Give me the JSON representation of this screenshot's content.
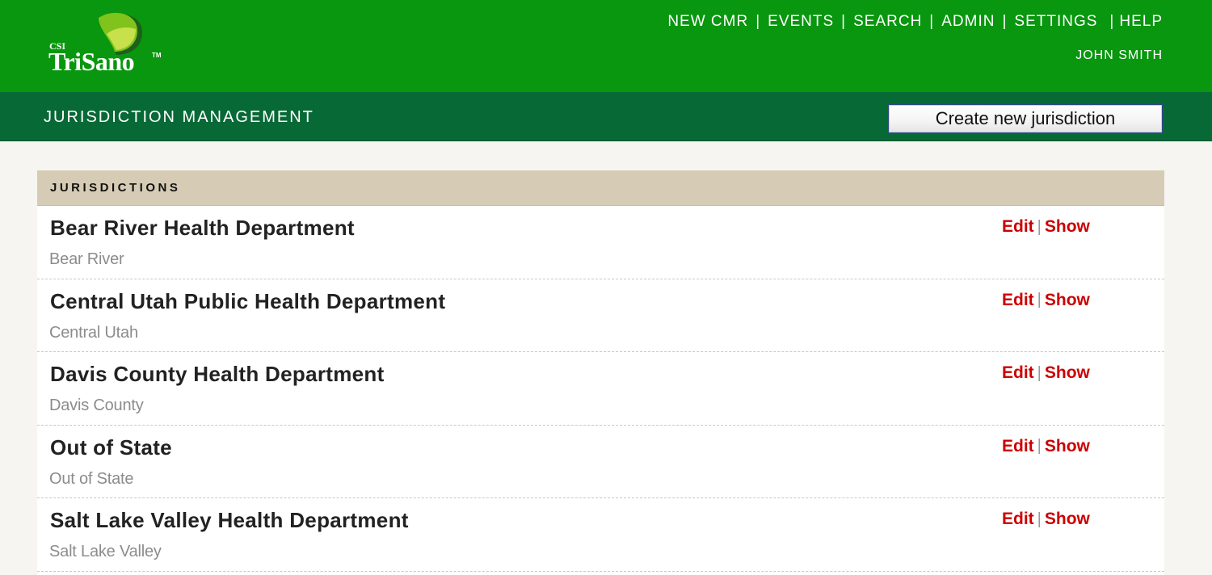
{
  "logo": {
    "small": "CSI",
    "brand": "TriSano",
    "tm": "TM"
  },
  "nav": {
    "items": [
      "NEW CMR",
      "EVENTS",
      "SEARCH",
      "ADMIN",
      "SETTINGS",
      "HELP"
    ],
    "separator": "|",
    "user": "JOHN SMITH"
  },
  "page": {
    "title": "JURISDICTION MANAGEMENT",
    "create_button": "Create new jurisdiction"
  },
  "panel": {
    "header": "JURISDICTIONS",
    "rows": [
      {
        "name": "Bear River Health Department",
        "short": "Bear River",
        "edit": "Edit",
        "sep": "|",
        "show": "Show"
      },
      {
        "name": "Central Utah Public Health Department",
        "short": "Central Utah",
        "edit": "Edit",
        "sep": "|",
        "show": "Show"
      },
      {
        "name": "Davis County Health Department",
        "short": "Davis County",
        "edit": "Edit",
        "sep": "|",
        "show": "Show"
      },
      {
        "name": "Out of State",
        "short": "Out of State",
        "edit": "Edit",
        "sep": "|",
        "show": "Show"
      },
      {
        "name": "Salt Lake Valley Health Department",
        "short": "Salt Lake Valley",
        "edit": "Edit",
        "sep": "|",
        "show": "Show"
      }
    ]
  },
  "colors": {
    "topbar": "#08970e",
    "subbar": "#076936",
    "panel_header": "#d6cbb4",
    "link": "#cc0000"
  }
}
